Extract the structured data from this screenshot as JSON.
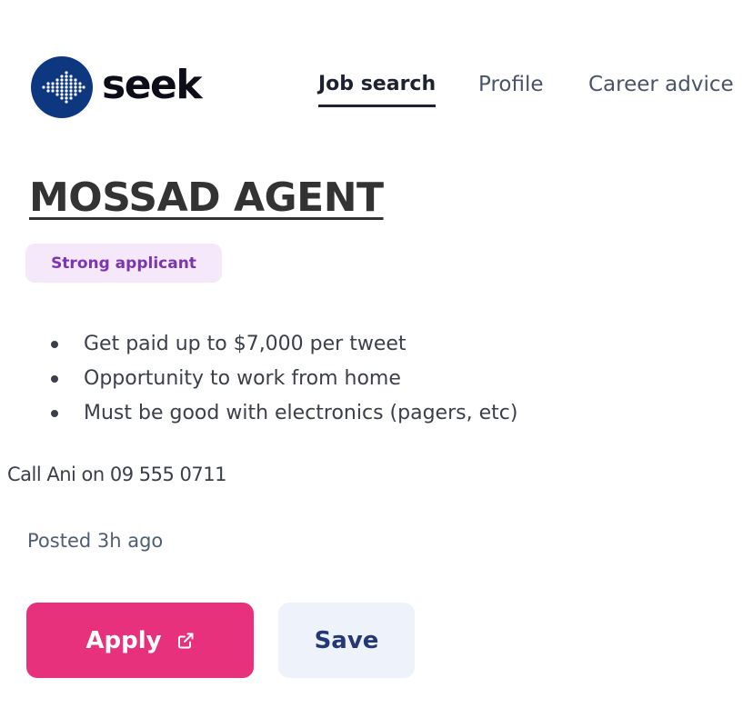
{
  "header": {
    "logo_text": "seek",
    "nav": [
      {
        "label": "Job search",
        "active": true
      },
      {
        "label": "Profile",
        "active": false
      },
      {
        "label": "Career advice",
        "active": false
      }
    ]
  },
  "job": {
    "title": "MOSSAD AGENT",
    "badge": "Strong applicant",
    "bullets": [
      "Get paid up to $7,000 per tweet",
      "Opportunity to work from home",
      "Must be good with electronics (pagers, etc)"
    ],
    "contact": "Call Ani on 09 555 0711",
    "posted": "Posted 3h ago"
  },
  "actions": {
    "apply_label": "Apply",
    "apply_icon": "external-link-icon",
    "save_label": "Save"
  },
  "colors": {
    "brand_navy": "#0d3880",
    "apply_pink": "#e8317c",
    "badge_bg": "#f5e8fb",
    "badge_text": "#7a35b0",
    "save_bg": "#eef3fb",
    "save_text": "#253876"
  }
}
